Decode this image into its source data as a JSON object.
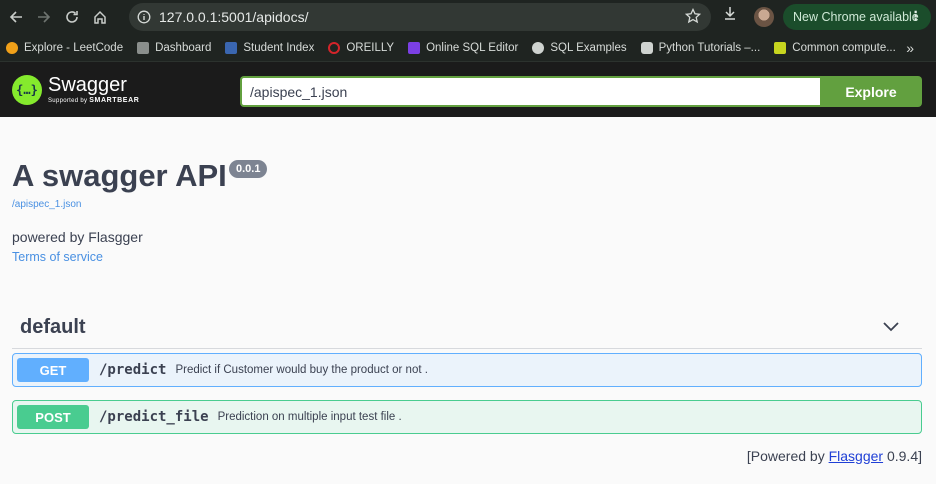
{
  "browser": {
    "url": "127.0.0.1:5001/apidocs/",
    "new_chrome_label": "New Chrome available"
  },
  "bookmarks": [
    {
      "label": "Explore - LeetCode",
      "color": "#f0a019"
    },
    {
      "label": "Dashboard",
      "color": "#8a8f8c"
    },
    {
      "label": "Student Index",
      "color": "#3a66b0"
    },
    {
      "label": "OREILLY",
      "color": "#d3242a"
    },
    {
      "label": "Online SQL Editor",
      "color": "#7b3fe4"
    },
    {
      "label": "SQL Examples",
      "color": "#cfd3d0"
    },
    {
      "label": "Python Tutorials –...",
      "color": "#cfd3d0"
    },
    {
      "label": "Common compute...",
      "color": "#c7d51f"
    }
  ],
  "swagger": {
    "logo_title": "Swagger",
    "logo_sub_prefix": "Supported by",
    "logo_sub_brand": "SMARTBEAR",
    "spec_url": "/apispec_1.json",
    "explore_label": "Explore"
  },
  "info": {
    "title": "A swagger API",
    "version": "0.0.1",
    "spec_link": "/apispec_1.json",
    "description": "powered by Flasgger",
    "terms": "Terms of service"
  },
  "tag": {
    "name": "default",
    "operations": [
      {
        "method": "GET",
        "path": "/predict",
        "summary": "Predict if Customer would buy the product or not ."
      },
      {
        "method": "POST",
        "path": "/predict_file",
        "summary": "Prediction on multiple input test file ."
      }
    ]
  },
  "footer": {
    "prefix": "[Powered by ",
    "link": "Flasgger",
    "suffix": " 0.9.4]"
  },
  "colors": {
    "get": "#61affe",
    "post": "#49cc90",
    "explore": "#62a03f",
    "link": "#4990e2"
  }
}
